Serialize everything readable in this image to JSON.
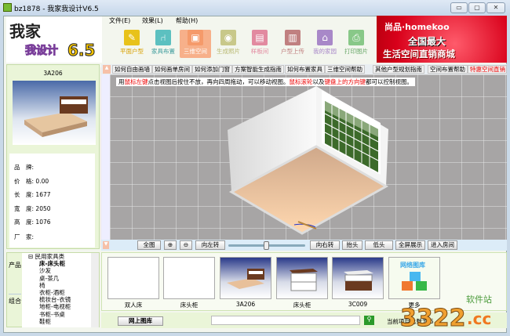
{
  "window": {
    "title": "bz1878 - 我家我设计V6.5",
    "controls": [
      "▭",
      "▢",
      "✕"
    ]
  },
  "logo": {
    "text": "我家我设计",
    "version": "6.5"
  },
  "menu": [
    "文件(E)",
    "效果(L)",
    "帮助(H)"
  ],
  "toolbar": [
    {
      "label": "平面户型",
      "color": "#e8c21a",
      "icon": "pencil-icon"
    },
    {
      "label": "家具布置",
      "color": "#5cc0c0",
      "icon": "chair-icon"
    },
    {
      "label": "三维空间",
      "color": "#f59a6a",
      "icon": "cube-icon"
    },
    {
      "label": "生成照片",
      "color": "#c8c88a",
      "icon": "camera-icon"
    },
    {
      "label": "样板间",
      "color": "#e28aa0",
      "icon": "room-icon"
    },
    {
      "label": "户型上传",
      "color": "#c08080",
      "icon": "upload-icon"
    },
    {
      "label": "我的家园",
      "color": "#a888c8",
      "icon": "house-icon"
    },
    {
      "label": "打印图片",
      "color": "#88c888",
      "icon": "printer-icon"
    }
  ],
  "banner": {
    "brand": "尚品·homekoo",
    "line1": "全国最大",
    "line2": "生活空间直销商城"
  },
  "product": {
    "name": "3A206",
    "fields": [
      {
        "label": "品　牌:",
        "value": ""
      },
      {
        "label": "价　格:",
        "value": "0.00"
      },
      {
        "label": "长　度:",
        "value": "1677"
      },
      {
        "label": "宽　度:",
        "value": "2050"
      },
      {
        "label": "高　度:",
        "value": "1076"
      },
      {
        "label": "厂　家:",
        "value": ""
      }
    ]
  },
  "tree": {
    "tabs": [
      "产品",
      "组合"
    ],
    "root": "民用家具类",
    "items": [
      "床-床头柜",
      "沙发",
      "桌-茶几",
      "椅",
      "衣柜-酒柜",
      "梳妆台-衣镜",
      "地柜-电视柜",
      "书柜-书桌",
      "鞋柜"
    ]
  },
  "help_tabs": [
    "如何自由画墙",
    "如何画单房间",
    "如何添加门窗",
    "方案智能生成指南",
    "如何布置家具",
    "三维空间帮助",
    "其他户型规划指南",
    "空间布置帮助",
    "特惠空间直销"
  ],
  "hint": {
    "p1": "用",
    "r1": "鼠标左键",
    "p2": "点击视图后按住不放，再向四周拖动，可以移动视图。",
    "r2": "鼠标滚轮",
    "p3": "以及",
    "r3": "键盘上的方向键",
    "p4": "都可以控制视图。"
  },
  "view_controls": {
    "full": "全图",
    "rotate_left": "向左转",
    "rotate_right": "向右转",
    "look_up": "抬头",
    "look_down": "低头",
    "fullscreen": "全屏展示",
    "enter_room": "进入房间",
    "slider": 0.5
  },
  "thumbnails": [
    "双人床",
    "床头柜",
    "3A206",
    "床头柜",
    "3C009",
    "更多"
  ],
  "netlib": "网络图库",
  "bottom": {
    "button": "网上图库",
    "search_placeholder": "",
    "status": "当前项目总数为 5"
  },
  "watermark": "3322.cc 软件站"
}
